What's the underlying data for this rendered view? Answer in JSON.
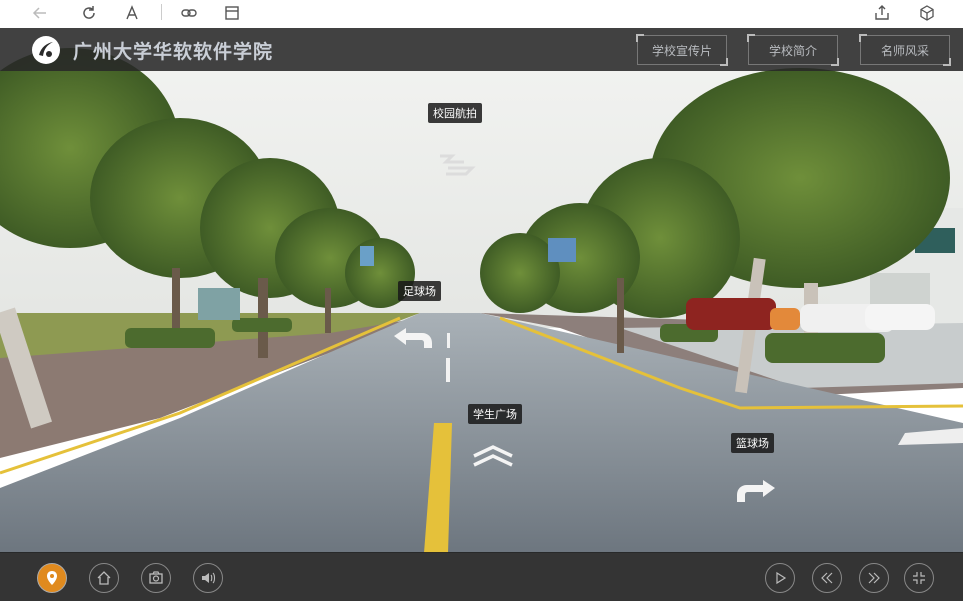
{
  "browser_toolbar": {
    "icons": [
      "back-arrow-icon",
      "reload-icon",
      "text-size-icon",
      "link-icon",
      "window-icon",
      "share-icon",
      "cube-icon"
    ]
  },
  "header": {
    "title": "广州大学华软软件学院",
    "buttons": [
      {
        "label": "学校宣传片"
      },
      {
        "label": "学校简介"
      },
      {
        "label": "名师风采"
      }
    ]
  },
  "hotspots": [
    {
      "label": "校园航拍",
      "icon": "plane-icon"
    },
    {
      "label": "足球场",
      "icon": "turn-left-arrow-icon"
    },
    {
      "label": "学生广场",
      "icon": "forward-arrow-icon"
    },
    {
      "label": "篮球场",
      "icon": "turn-right-arrow-icon"
    }
  ],
  "bottom_controls": {
    "left": [
      "map-pin-icon",
      "home-icon",
      "camera-icon",
      "sound-icon"
    ],
    "right": [
      "play-icon",
      "previous-icon",
      "next-icon",
      "fullscreen-icon"
    ]
  },
  "colors": {
    "header_bg": "#2b2b2b",
    "road": "#7d8893",
    "lane_yellow": "#e5c13a",
    "accent_orange": "#e08a1e"
  }
}
